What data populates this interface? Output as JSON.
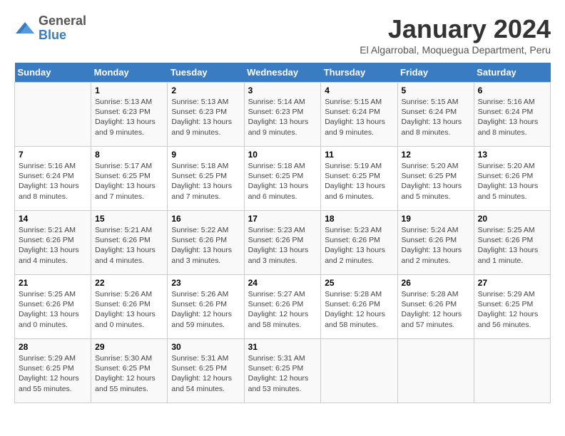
{
  "logo": {
    "general": "General",
    "blue": "Blue"
  },
  "header": {
    "title": "January 2024",
    "subtitle": "El Algarrobal, Moquegua Department, Peru"
  },
  "days_of_week": [
    "Sunday",
    "Monday",
    "Tuesday",
    "Wednesday",
    "Thursday",
    "Friday",
    "Saturday"
  ],
  "weeks": [
    [
      {
        "day": "",
        "sunrise": "",
        "sunset": "",
        "daylight": ""
      },
      {
        "day": "1",
        "sunrise": "Sunrise: 5:13 AM",
        "sunset": "Sunset: 6:23 PM",
        "daylight": "Daylight: 13 hours and 9 minutes."
      },
      {
        "day": "2",
        "sunrise": "Sunrise: 5:13 AM",
        "sunset": "Sunset: 6:23 PM",
        "daylight": "Daylight: 13 hours and 9 minutes."
      },
      {
        "day": "3",
        "sunrise": "Sunrise: 5:14 AM",
        "sunset": "Sunset: 6:23 PM",
        "daylight": "Daylight: 13 hours and 9 minutes."
      },
      {
        "day": "4",
        "sunrise": "Sunrise: 5:15 AM",
        "sunset": "Sunset: 6:24 PM",
        "daylight": "Daylight: 13 hours and 9 minutes."
      },
      {
        "day": "5",
        "sunrise": "Sunrise: 5:15 AM",
        "sunset": "Sunset: 6:24 PM",
        "daylight": "Daylight: 13 hours and 8 minutes."
      },
      {
        "day": "6",
        "sunrise": "Sunrise: 5:16 AM",
        "sunset": "Sunset: 6:24 PM",
        "daylight": "Daylight: 13 hours and 8 minutes."
      }
    ],
    [
      {
        "day": "7",
        "sunrise": "Sunrise: 5:16 AM",
        "sunset": "Sunset: 6:24 PM",
        "daylight": "Daylight: 13 hours and 8 minutes."
      },
      {
        "day": "8",
        "sunrise": "Sunrise: 5:17 AM",
        "sunset": "Sunset: 6:25 PM",
        "daylight": "Daylight: 13 hours and 7 minutes."
      },
      {
        "day": "9",
        "sunrise": "Sunrise: 5:18 AM",
        "sunset": "Sunset: 6:25 PM",
        "daylight": "Daylight: 13 hours and 7 minutes."
      },
      {
        "day": "10",
        "sunrise": "Sunrise: 5:18 AM",
        "sunset": "Sunset: 6:25 PM",
        "daylight": "Daylight: 13 hours and 6 minutes."
      },
      {
        "day": "11",
        "sunrise": "Sunrise: 5:19 AM",
        "sunset": "Sunset: 6:25 PM",
        "daylight": "Daylight: 13 hours and 6 minutes."
      },
      {
        "day": "12",
        "sunrise": "Sunrise: 5:20 AM",
        "sunset": "Sunset: 6:25 PM",
        "daylight": "Daylight: 13 hours and 5 minutes."
      },
      {
        "day": "13",
        "sunrise": "Sunrise: 5:20 AM",
        "sunset": "Sunset: 6:26 PM",
        "daylight": "Daylight: 13 hours and 5 minutes."
      }
    ],
    [
      {
        "day": "14",
        "sunrise": "Sunrise: 5:21 AM",
        "sunset": "Sunset: 6:26 PM",
        "daylight": "Daylight: 13 hours and 4 minutes."
      },
      {
        "day": "15",
        "sunrise": "Sunrise: 5:21 AM",
        "sunset": "Sunset: 6:26 PM",
        "daylight": "Daylight: 13 hours and 4 minutes."
      },
      {
        "day": "16",
        "sunrise": "Sunrise: 5:22 AM",
        "sunset": "Sunset: 6:26 PM",
        "daylight": "Daylight: 13 hours and 3 minutes."
      },
      {
        "day": "17",
        "sunrise": "Sunrise: 5:23 AM",
        "sunset": "Sunset: 6:26 PM",
        "daylight": "Daylight: 13 hours and 3 minutes."
      },
      {
        "day": "18",
        "sunrise": "Sunrise: 5:23 AM",
        "sunset": "Sunset: 6:26 PM",
        "daylight": "Daylight: 13 hours and 2 minutes."
      },
      {
        "day": "19",
        "sunrise": "Sunrise: 5:24 AM",
        "sunset": "Sunset: 6:26 PM",
        "daylight": "Daylight: 13 hours and 2 minutes."
      },
      {
        "day": "20",
        "sunrise": "Sunrise: 5:25 AM",
        "sunset": "Sunset: 6:26 PM",
        "daylight": "Daylight: 13 hours and 1 minute."
      }
    ],
    [
      {
        "day": "21",
        "sunrise": "Sunrise: 5:25 AM",
        "sunset": "Sunset: 6:26 PM",
        "daylight": "Daylight: 13 hours and 0 minutes."
      },
      {
        "day": "22",
        "sunrise": "Sunrise: 5:26 AM",
        "sunset": "Sunset: 6:26 PM",
        "daylight": "Daylight: 13 hours and 0 minutes."
      },
      {
        "day": "23",
        "sunrise": "Sunrise: 5:26 AM",
        "sunset": "Sunset: 6:26 PM",
        "daylight": "Daylight: 12 hours and 59 minutes."
      },
      {
        "day": "24",
        "sunrise": "Sunrise: 5:27 AM",
        "sunset": "Sunset: 6:26 PM",
        "daylight": "Daylight: 12 hours and 58 minutes."
      },
      {
        "day": "25",
        "sunrise": "Sunrise: 5:28 AM",
        "sunset": "Sunset: 6:26 PM",
        "daylight": "Daylight: 12 hours and 58 minutes."
      },
      {
        "day": "26",
        "sunrise": "Sunrise: 5:28 AM",
        "sunset": "Sunset: 6:26 PM",
        "daylight": "Daylight: 12 hours and 57 minutes."
      },
      {
        "day": "27",
        "sunrise": "Sunrise: 5:29 AM",
        "sunset": "Sunset: 6:25 PM",
        "daylight": "Daylight: 12 hours and 56 minutes."
      }
    ],
    [
      {
        "day": "28",
        "sunrise": "Sunrise: 5:29 AM",
        "sunset": "Sunset: 6:25 PM",
        "daylight": "Daylight: 12 hours and 55 minutes."
      },
      {
        "day": "29",
        "sunrise": "Sunrise: 5:30 AM",
        "sunset": "Sunset: 6:25 PM",
        "daylight": "Daylight: 12 hours and 55 minutes."
      },
      {
        "day": "30",
        "sunrise": "Sunrise: 5:31 AM",
        "sunset": "Sunset: 6:25 PM",
        "daylight": "Daylight: 12 hours and 54 minutes."
      },
      {
        "day": "31",
        "sunrise": "Sunrise: 5:31 AM",
        "sunset": "Sunset: 6:25 PM",
        "daylight": "Daylight: 12 hours and 53 minutes."
      },
      {
        "day": "",
        "sunrise": "",
        "sunset": "",
        "daylight": ""
      },
      {
        "day": "",
        "sunrise": "",
        "sunset": "",
        "daylight": ""
      },
      {
        "day": "",
        "sunrise": "",
        "sunset": "",
        "daylight": ""
      }
    ]
  ]
}
